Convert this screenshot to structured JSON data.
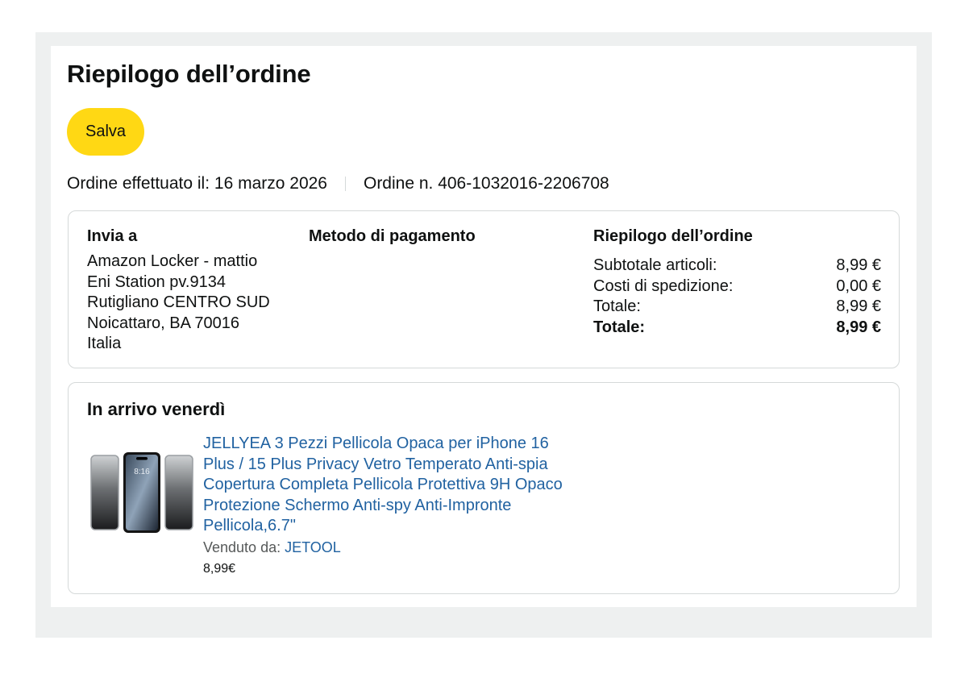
{
  "header": {
    "title": "Riepilogo dell’ordine",
    "save_label": "Salva"
  },
  "order_meta": {
    "placed_on": "Ordine effettuato il: 16 marzo 2026",
    "order_number": "Ordine n. 406-1032016-2206708"
  },
  "summary_card": {
    "ship_to": {
      "heading": "Invia a",
      "lines": [
        "Amazon Locker - mattio",
        "Eni Station pv.9134",
        "Rutigliano CENTRO SUD",
        "Noicattaro, BA 70016",
        "Italia"
      ]
    },
    "payment": {
      "heading": "Metodo di pagamento"
    },
    "order_summary": {
      "heading": "Riepilogo dell’ordine",
      "rows": [
        {
          "label": "Subtotale articoli:",
          "value": "8,99 €"
        },
        {
          "label": "Costi di spedizione:",
          "value": "0,00 €"
        },
        {
          "label": "Totale:",
          "value": "8,99 €"
        },
        {
          "label": "Totale:",
          "value": "8,99 €"
        }
      ]
    }
  },
  "delivery_card": {
    "arrival": "In arrivo venerdì",
    "product": {
      "title": "JELLYEA 3 Pezzi Pellicola Opaca per iPhone 16 Plus / 15 Plus Privacy Vetro Temperato Anti-spia Copertura Completa Pellicola Protettiva 9H Opaco Protezione Schermo Anti-spy Anti-Impronte Pellicola,6.7\"",
      "sold_by_label": "Venduto da:",
      "seller": "JETOOL",
      "price": "8,99€",
      "image_icon": "phone-screen-protector-image",
      "screen_time": "8:16"
    }
  },
  "colors": {
    "accent_button": "#ffd814",
    "link": "#2162a1",
    "background": "#eef0f0",
    "border": "#d5d9d9"
  }
}
